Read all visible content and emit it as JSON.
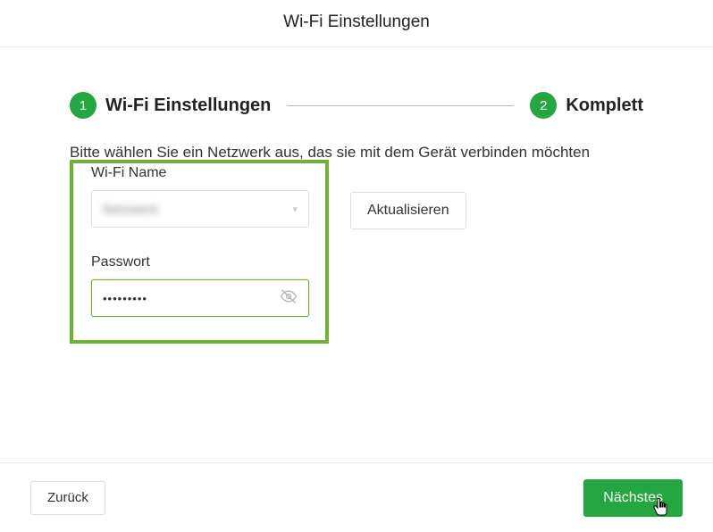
{
  "header": {
    "title": "Wi-Fi Einstellungen"
  },
  "steps": {
    "step1": {
      "num": "1",
      "label": "Wi-Fi Einstellungen"
    },
    "step2": {
      "num": "2",
      "label": "Komplett"
    }
  },
  "instruction": "Bitte wählen Sie ein Netzwerk aus, das sie mit dem Gerät verbinden möchten",
  "fields": {
    "wifi_name_label": "Wi-Fi Name",
    "wifi_name_value": "Netzwerk",
    "refresh_label": "Aktualisieren",
    "password_label": "Passwort",
    "password_value": "•••••••••"
  },
  "footer": {
    "back_label": "Zurück",
    "next_label": "Nächstes"
  }
}
